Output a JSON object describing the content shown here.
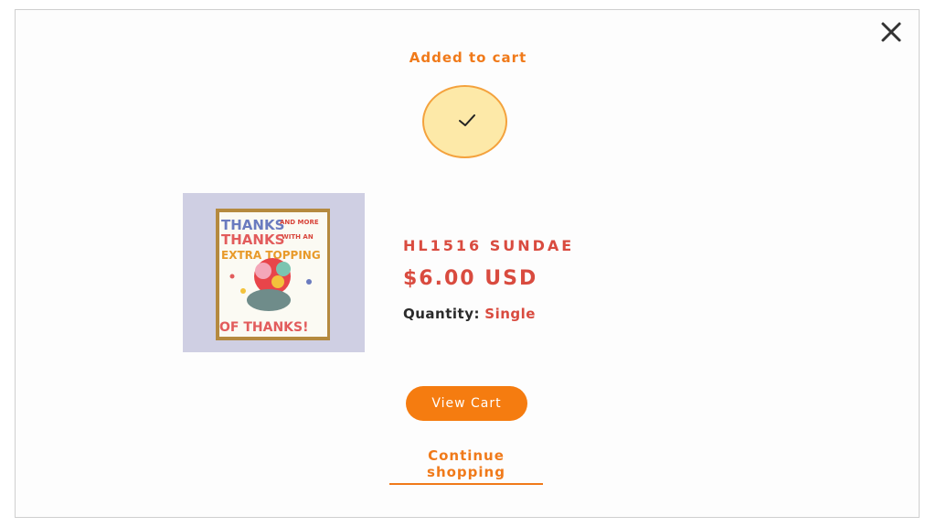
{
  "modal": {
    "title": "Added to cart",
    "close_icon": "close-icon",
    "check_icon": "checkmark-icon"
  },
  "product": {
    "name": "HL1516 SUNDAE",
    "price": "$6.00 USD",
    "quantity_label": "Quantity:",
    "quantity_value": "Single",
    "image_text": [
      "THANKS",
      "AND MORE",
      "THANKS",
      "WITH AN",
      "EXTRA TOPPING",
      "OF THANKS!"
    ]
  },
  "actions": {
    "view_cart_label": "View Cart",
    "continue_label": "Continue shopping"
  },
  "colors": {
    "accent_orange": "#f57c10",
    "product_red": "#d94b3f",
    "check_circle_fill": "#fde9a8"
  }
}
